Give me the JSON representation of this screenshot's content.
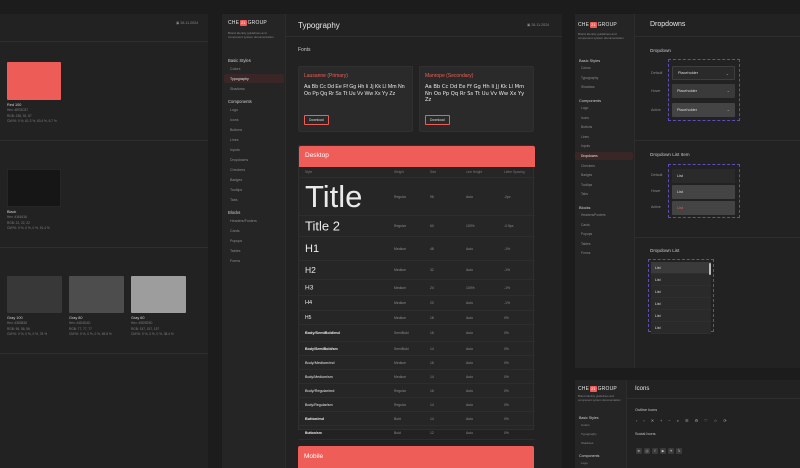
{
  "left_frame": {
    "date": "26.11.2024",
    "swatches": [
      {
        "name": "Red 100",
        "hex": "Hex: #EE5C57",
        "rgb": "RGB: 238, 92, 87",
        "cmyk": "CMYK: 0 %, 61.3 %, 63.4 %, 6.7 %",
        "color": "#ee5c57"
      },
      {
        "name": "Black",
        "hex": "Hex: #161616",
        "rgb": "RGB: 22, 22, 22",
        "cmyk": "CMYK: 0 %, 0 %, 0 %, 91.4 %",
        "color": "#161616"
      },
      {
        "name": "Gray 100",
        "hex": "Hex: #383838",
        "rgb": "RGB: 56, 56, 56",
        "cmyk": "CMYK: 0 %, 0 %, 0 %, 78 %",
        "color": "#383838"
      },
      {
        "name": "Gray 80",
        "hex": "Hex: #4D4D4D",
        "rgb": "RGB: 77, 77, 77",
        "cmyk": "CMYK: 0 %, 0 %, 0 %, 69.8 %",
        "color": "#4d4d4d"
      },
      {
        "name": "Gray 60",
        "hex": "Hex: #9D9D9D",
        "rgb": "RGB: 157, 157, 157",
        "cmyk": "CMYK: 0 %, 0 %, 0 %, 38.4 %",
        "color": "#9d9d9d"
      }
    ]
  },
  "brand": {
    "pre": "CHE",
    "chip": "21",
    "post": "GROUP",
    "tagline": "Brand identity guidelines and component system documentation"
  },
  "typography_frame": {
    "title": "Typography",
    "date": "26.11.2024",
    "sidebar": {
      "basic_header": "Basic Styles",
      "basic_items": [
        "Colors",
        "Typography",
        "Shadows"
      ],
      "components_header": "Components",
      "components_items": [
        "Logo",
        "Icons",
        "Buttons",
        "Lines",
        "Inputs",
        "Dropdowns",
        "Checkers",
        "Badges",
        "Tooltips",
        "Tabs"
      ],
      "blocks_header": "Blocks",
      "blocks_items": [
        "Headers/Footers",
        "Cards",
        "Popups",
        "Tables",
        "Forms"
      ]
    },
    "fonts_label": "Fonts",
    "font_cards": [
      {
        "title": "Lausanne (Primary)",
        "sample": "Aa Bb Cc Dd Ee Ff Gg Hh Ii Jj Kk Ll Mm Nn Oo Pp Qq Rr Ss Tt Uu Vv Ww Xx Yy Zz",
        "button": "Download"
      },
      {
        "title": "Manrope (Secondary)",
        "sample": "Aa Bb Cc Dd Ee Ff Gg Hh Ii Jj Kk Ll Mm Nn Oo Pp Qq Rr Ss Tt Uu Vv Ww Xx Yy Zz",
        "button": "Download"
      }
    ],
    "desktop_header": "Desktop",
    "columns": [
      "Style",
      "Weight",
      "Size",
      "Line Height",
      "Letter Spacing"
    ],
    "rows": [
      {
        "style": "Title",
        "weight": "Regular",
        "size": "96",
        "lh": "Auto",
        "ls": "-2px"
      },
      {
        "style": "Title 2",
        "weight": "Regular",
        "size": "60",
        "lh": "100%",
        "ls": "-0.5px"
      },
      {
        "style": "H1",
        "weight": "Medium",
        "size": "48",
        "lh": "Auto",
        "ls": "-1%"
      },
      {
        "style": "H2",
        "weight": "Medium",
        "size": "32",
        "lh": "Auto",
        "ls": "-1%"
      },
      {
        "style": "H3",
        "weight": "Medium",
        "size": "24",
        "lh": "100%",
        "ls": "-1%"
      },
      {
        "style": "H4",
        "weight": "Medium",
        "size": "20",
        "lh": "Auto",
        "ls": "-1%"
      },
      {
        "style": "H5",
        "weight": "Medium",
        "size": "18",
        "lh": "Auto",
        "ls": "0%"
      },
      {
        "style": "Body/SemiBold/md",
        "weight": "SemiBold",
        "size": "16",
        "lh": "Auto",
        "ls": "0%"
      },
      {
        "style": "Body/SemiBold/sm",
        "weight": "SemiBold",
        "size": "14",
        "lh": "Auto",
        "ls": "0%"
      },
      {
        "style": "Body/Medium/md",
        "weight": "Medium",
        "size": "16",
        "lh": "Auto",
        "ls": "0%"
      },
      {
        "style": "Body/Medium/sm",
        "weight": "Medium",
        "size": "14",
        "lh": "Auto",
        "ls": "0%"
      },
      {
        "style": "Body/Regular/md",
        "weight": "Regular",
        "size": "16",
        "lh": "Auto",
        "ls": "0%"
      },
      {
        "style": "Body/Regular/sm",
        "weight": "Regular",
        "size": "14",
        "lh": "Auto",
        "ls": "0%"
      },
      {
        "style": "Button/md",
        "weight": "Bold",
        "size": "14",
        "lh": "Auto",
        "ls": "0%"
      },
      {
        "style": "Button/sm",
        "weight": "Bold",
        "size": "12",
        "lh": "Auto",
        "ls": "0%"
      }
    ],
    "mobile_header": "Mobile"
  },
  "dropdowns_frame": {
    "title": "Dropdowns",
    "dropdown_label": "Dropdown",
    "states": [
      "Default",
      "Hover",
      "Active"
    ],
    "placeholder": "Placeholder",
    "list_item_label": "Dropdown List Item",
    "list_item_text": "List",
    "list_label": "Dropdown List",
    "list_items": [
      "List",
      "List",
      "List",
      "List",
      "List",
      "List"
    ]
  },
  "icons_frame": {
    "title": "Icons",
    "outline_label": "Outline Icons",
    "outline_icons": [
      "‹",
      "›",
      "✕",
      "+",
      "−",
      "⌕",
      "☰",
      "⚙",
      "♡",
      "☆",
      "⟳"
    ],
    "social_label": "Social Icons",
    "social_icons": [
      "in",
      "◎",
      "f",
      "▶",
      "✈",
      "𝕏"
    ]
  },
  "colors": {
    "accent": "#ef5d58",
    "bg": "#1c1c1c",
    "panel": "#222222",
    "purple": "#5b4fb7"
  }
}
